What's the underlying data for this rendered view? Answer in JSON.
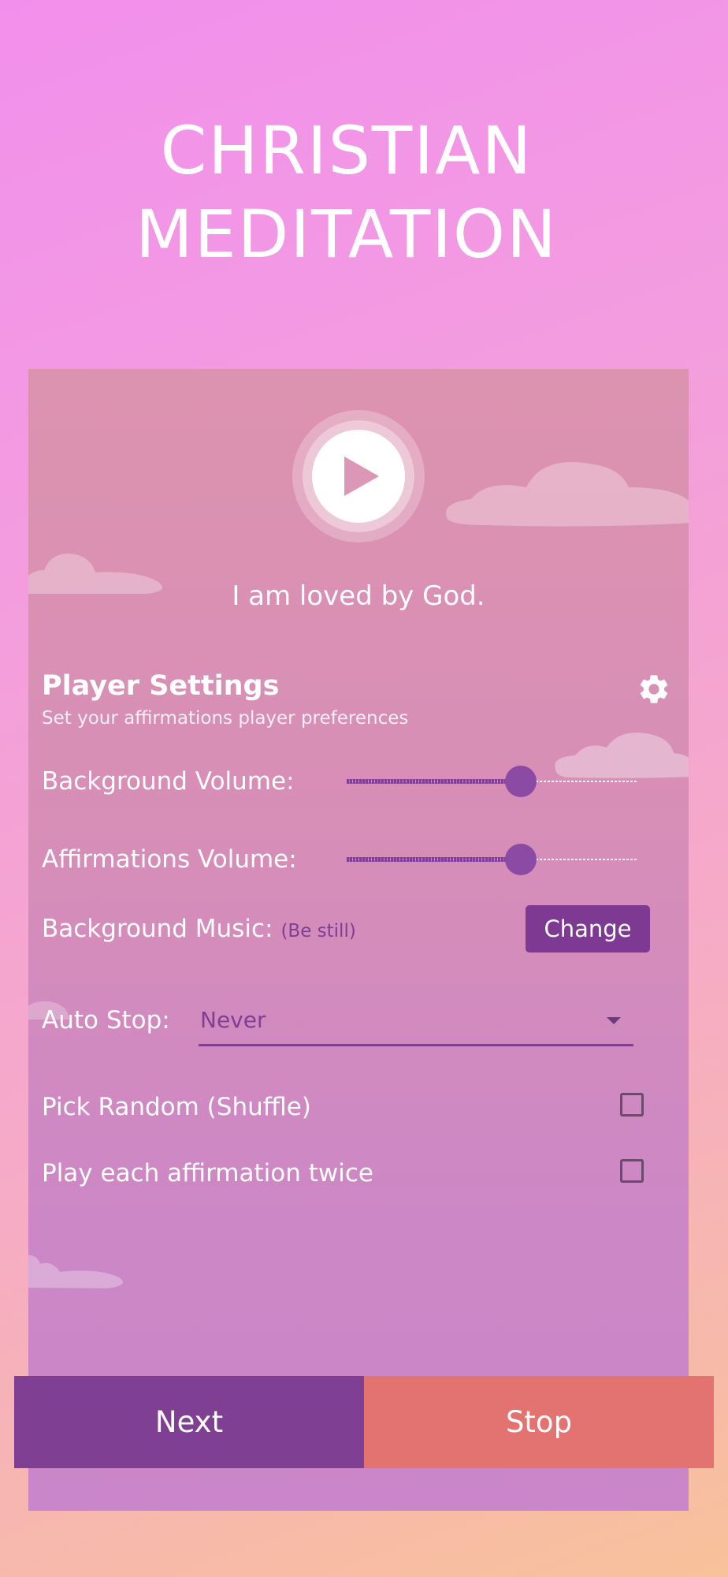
{
  "headline": {
    "line1": "CHRISTIAN",
    "line2": "MEDITATION"
  },
  "player": {
    "play_icon": "play-icon",
    "affirmation_text": "I am loved by God."
  },
  "settings": {
    "title": "Player Settings",
    "subtitle": "Set your affirmations player preferences",
    "gear_icon": "gear-icon",
    "background_volume": {
      "label": "Background Volume:",
      "level_percent": 60
    },
    "affirmations_volume": {
      "label": "Affirmations Volume:",
      "level_percent": 60
    },
    "background_music": {
      "label": "Background Music:",
      "current": "(Be still)",
      "button_label": "Change"
    },
    "auto_stop": {
      "label": "Auto Stop:",
      "selected": "Never"
    },
    "shuffle": {
      "label": "Pick Random (Shuffle)",
      "checked": false
    },
    "play_twice": {
      "label": "Play each affirmation twice",
      "checked": false
    }
  },
  "actions": {
    "next_label": "Next",
    "stop_label": "Stop"
  },
  "colors": {
    "accent_purple": "#7e3a92",
    "stop_red": "#e27371",
    "next_purple": "#7f4094"
  }
}
